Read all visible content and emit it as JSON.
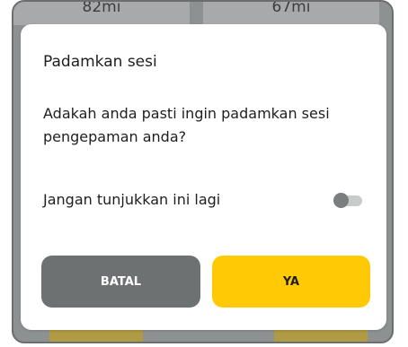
{
  "background": {
    "left_card_text": "82mi",
    "right_card_text": "67mi"
  },
  "dialog": {
    "title": "Padamkan sesi",
    "message": "Adakah anda pasti ingin padamkan sesi pengepaman anda?",
    "option_label": "Jangan tunjukkan ini lagi",
    "option_toggle_on": false,
    "cancel_label": "BATAL",
    "confirm_label": "YA"
  },
  "colors": {
    "accent": "#ffca05",
    "cancel_button": "#6e7172",
    "toggle_knob": "#7b7d7e",
    "toggle_track": "#c9caca"
  }
}
